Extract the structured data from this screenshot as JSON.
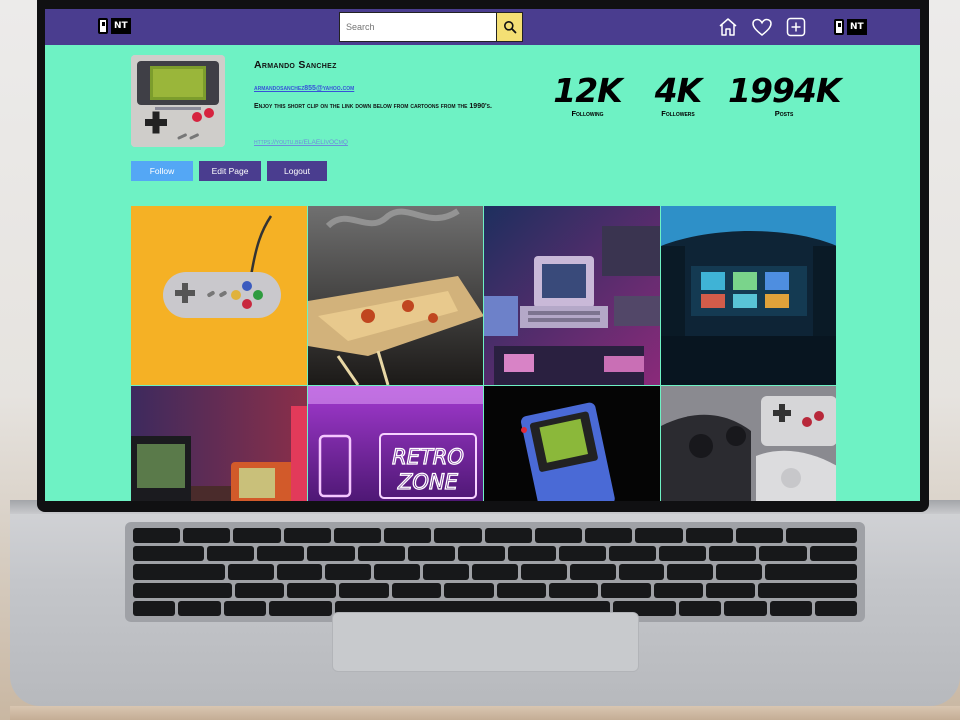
{
  "app": {
    "logo_text": "NT",
    "search_placeholder": "Search"
  },
  "profile": {
    "name": "Armando Sanchez",
    "email": "armandosanchez855@yahoo.com",
    "bio": "Enjoy this short clip on the link down below from cartoons from the 1990's.",
    "link": "https://youtu.be/ELAELIvOCmQ"
  },
  "stats": [
    {
      "value": "12K",
      "label": "Following"
    },
    {
      "value": "4K",
      "label": "Followers"
    },
    {
      "value": "1994K",
      "label": "Posts"
    }
  ],
  "buttons": {
    "follow": "Follow",
    "edit_page": "Edit Page",
    "logout": "Logout"
  },
  "icons": [
    "search-icon",
    "home-icon",
    "heart-icon",
    "add-post-icon"
  ],
  "posts": [
    {
      "subject": "snes-controller-on-yellow"
    },
    {
      "subject": "melted-pizza-slice"
    },
    {
      "subject": "retro-computers-neon"
    },
    {
      "subject": "arcade-room"
    },
    {
      "subject": "old-tvs-neon"
    },
    {
      "subject": "retro-zone-neon-sign"
    },
    {
      "subject": "gameboy-on-black"
    },
    {
      "subject": "console-controllers"
    }
  ],
  "post_sign_text": [
    "RETRO",
    "ZONE"
  ],
  "colors": {
    "page_bg": "#6ef2c4",
    "navbar": "#4a3d8f",
    "search_button": "#f4df74",
    "follow_button": "#54a7f5",
    "email_link": "#3853d8"
  }
}
